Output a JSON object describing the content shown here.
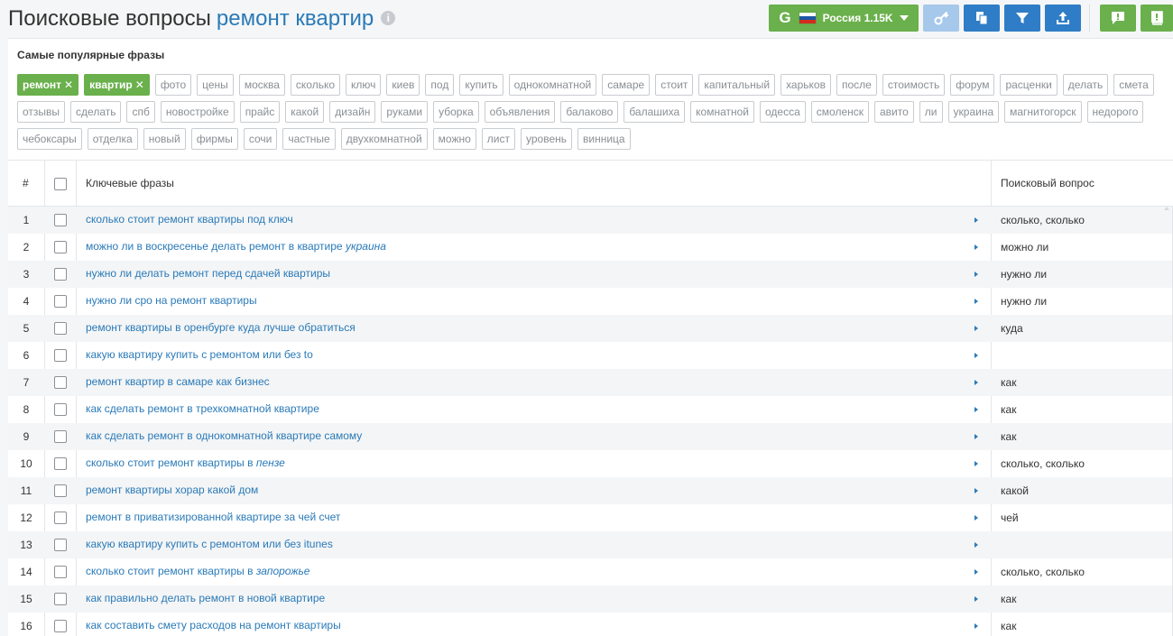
{
  "header": {
    "title": "Поисковые вопросы",
    "query": "ремонт квартир",
    "info_icon": "i",
    "engine_letter": "G",
    "region_label": "Россия 1.15K",
    "flag_colors": [
      "#ffffff",
      "#1c57a5",
      "#d52b1e"
    ]
  },
  "popular": {
    "title": "Самые популярные фразы",
    "active_tags": [
      "ремонт",
      "квартир"
    ],
    "remove_glyph": "✕",
    "rows": [
      [
        "фото",
        "цены",
        "москва",
        "сколько",
        "ключ",
        "киев",
        "под",
        "купить",
        "однокомнатной",
        "самаре",
        "стоит",
        "капитальный",
        "харьков",
        "после",
        "стоимость",
        "форум",
        "расценки",
        "делать",
        "смета"
      ],
      [
        "отзывы",
        "сделать",
        "спб",
        "новостройке",
        "прайс",
        "какой",
        "дизайн",
        "руками",
        "уборка",
        "объявления",
        "балаково",
        "балашиха",
        "комнатной",
        "одесса",
        "смоленск",
        "авито",
        "ли",
        "украина",
        "магнитогорск",
        "недорого"
      ],
      [
        "чебоксары",
        "отделка",
        "новый",
        "фирмы",
        "сочи",
        "частные",
        "двухкомнатной",
        "можно",
        "лист",
        "уровень",
        "винница"
      ]
    ]
  },
  "table": {
    "col_num": "#",
    "col_keywords": "Ключевые фразы",
    "col_question": "Поисковый вопрос",
    "rows": [
      {
        "n": "1",
        "text": "сколько стоит ремонт квартиры под ключ",
        "em": "",
        "q": "сколько, сколько"
      },
      {
        "n": "2",
        "text": "можно ли в воскресенье делать ремонт в квартире ",
        "em": "украина",
        "q": "можно ли"
      },
      {
        "n": "3",
        "text": "нужно ли делать ремонт перед сдачей квартиры",
        "em": "",
        "q": "нужно ли"
      },
      {
        "n": "4",
        "text": "нужно ли сро на ремонт квартиры",
        "em": "",
        "q": "нужно ли"
      },
      {
        "n": "5",
        "text": "ремонт квартиры в оренбурге куда лучше обратиться",
        "em": "",
        "q": "куда"
      },
      {
        "n": "6",
        "text": "какую квартиру купить с ремонтом или без to",
        "em": "",
        "q": ""
      },
      {
        "n": "7",
        "text": "ремонт квартир в самаре как бизнес",
        "em": "",
        "q": "как"
      },
      {
        "n": "8",
        "text": "как сделать ремонт в трехкомнатной квартире",
        "em": "",
        "q": "как"
      },
      {
        "n": "9",
        "text": "как сделать ремонт в однокомнатной квартире самому",
        "em": "",
        "q": "как"
      },
      {
        "n": "10",
        "text": "сколько стоит ремонт квартиры в ",
        "em": "пензе",
        "q": "сколько, сколько"
      },
      {
        "n": "11",
        "text": "ремонт квартиры хорар какой дом",
        "em": "",
        "q": "какой"
      },
      {
        "n": "12",
        "text": "ремонт в приватизированной квартире за чей счет",
        "em": "",
        "q": "чей"
      },
      {
        "n": "13",
        "text": "какую квартиру купить с ремонтом или без itunes",
        "em": "",
        "q": ""
      },
      {
        "n": "14",
        "text": "сколько стоит ремонт квартиры в ",
        "em": "запорожье",
        "q": "сколько, сколько"
      },
      {
        "n": "15",
        "text": "как правильно делать ремонт в новой квартире",
        "em": "",
        "q": "как"
      },
      {
        "n": "16",
        "text": "как составить смету расходов на ремонт квартиры",
        "em": "",
        "q": "как"
      }
    ]
  },
  "colors": {
    "green": "#6ab04c",
    "blue": "#2f7dc6",
    "light_blue": "#a6c8ea",
    "link": "#2a7ab8"
  }
}
